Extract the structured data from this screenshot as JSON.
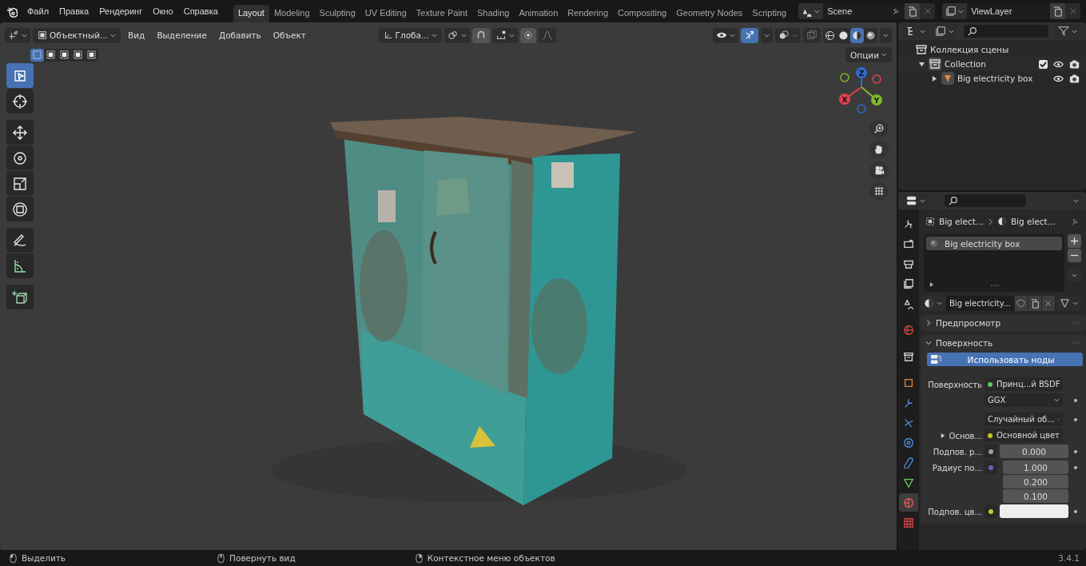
{
  "top_menu": [
    "Файл",
    "Правка",
    "Рендеринг",
    "Окно",
    "Справка"
  ],
  "workspaces": [
    {
      "label": "Layout",
      "selected": true
    },
    {
      "label": "Modeling",
      "selected": false
    },
    {
      "label": "Sculpting",
      "selected": false
    },
    {
      "label": "UV Editing",
      "selected": false
    },
    {
      "label": "Texture Paint",
      "selected": false
    },
    {
      "label": "Shading",
      "selected": false
    },
    {
      "label": "Animation",
      "selected": false
    },
    {
      "label": "Rendering",
      "selected": false
    },
    {
      "label": "Compositing",
      "selected": false
    },
    {
      "label": "Geometry Nodes",
      "selected": false
    },
    {
      "label": "Scripting",
      "selected": false
    }
  ],
  "scene": {
    "name": "Scene"
  },
  "view_layer": {
    "name": "ViewLayer"
  },
  "viewport": {
    "mode": "Объектный...",
    "menus": [
      "Вид",
      "Выделение",
      "Добавить",
      "Объект"
    ],
    "orientation": "Глоба...",
    "options": "Опции",
    "gizmo_on": true,
    "select_modes": [
      {
        "selected": true
      },
      {
        "selected": false
      },
      {
        "selected": false
      },
      {
        "selected": false
      },
      {
        "selected": false
      }
    ],
    "shading": [
      {
        "kind": "wireframe",
        "selected": false
      },
      {
        "kind": "solid",
        "selected": false
      },
      {
        "kind": "material",
        "selected": true
      },
      {
        "kind": "rendered",
        "selected": false
      }
    ],
    "tool_groups": [
      [
        {
          "kind": "select",
          "selected": true
        },
        {
          "kind": "cursor",
          "selected": false
        }
      ],
      [
        {
          "kind": "move",
          "selected": false
        },
        {
          "kind": "rotate",
          "selected": false
        },
        {
          "kind": "scale",
          "selected": false
        },
        {
          "kind": "transform",
          "selected": false
        }
      ],
      [
        {
          "kind": "annotate",
          "selected": false
        },
        {
          "kind": "measure",
          "selected": false
        }
      ],
      [
        {
          "kind": "add_cube",
          "selected": false
        }
      ]
    ],
    "axes": [
      {
        "label": "Z",
        "color": "#2f6ad0"
      },
      {
        "label": "X",
        "color": "#e0424f"
      },
      {
        "label": "Y",
        "color": "#80b82a"
      }
    ]
  },
  "outliner": {
    "tree": [
      {
        "label": "Коллекция сцены",
        "kind": "scene_collection",
        "children": [
          {
            "label": "Collection",
            "kind": "collection",
            "expanded": true,
            "checked": true,
            "children": [
              {
                "label": "Big electricity box",
                "kind": "mesh",
                "expanded": false
              }
            ]
          }
        ]
      }
    ]
  },
  "properties": {
    "tabs": [
      {
        "kind": "tool",
        "selected": false
      },
      {
        "kind": "render",
        "selected": false
      },
      {
        "kind": "output",
        "selected": false
      },
      {
        "kind": "view_layer",
        "selected": false
      },
      {
        "kind": "scene",
        "selected": false
      },
      {
        "kind": "world",
        "selected": false
      },
      {
        "kind": "collection",
        "selected": false
      },
      {
        "kind": "object",
        "selected": false
      },
      {
        "kind": "modifiers",
        "selected": false
      },
      {
        "kind": "particles",
        "selected": false
      },
      {
        "kind": "physics",
        "selected": false
      },
      {
        "kind": "constraints",
        "selected": false
      },
      {
        "kind": "data",
        "selected": false
      },
      {
        "kind": "material",
        "selected": true
      },
      {
        "kind": "texture",
        "selected": false
      }
    ],
    "breadcrumb": [
      "Big elect...",
      "Big elect..."
    ],
    "slots": [
      {
        "label": "Big electricity box",
        "selected": true
      }
    ],
    "material_name": "Big electricity...",
    "panels": [
      {
        "title": "Предпросмотр",
        "expanded": false
      },
      {
        "title": "Поверхность",
        "expanded": true
      }
    ],
    "use_nodes": "Использовать ноды",
    "rows": [
      {
        "kind": "link",
        "label": "Поверхность",
        "value": "Принц...й BSDF",
        "color": "#63c763"
      },
      {
        "kind": "dropdown",
        "value": "GGX"
      },
      {
        "kind": "dropdown",
        "value": "Случайный об..."
      },
      {
        "kind": "link",
        "label": "Основ...",
        "value": "Основной цвет",
        "color": "#c7c729",
        "expandable": true
      },
      {
        "kind": "number",
        "label": "Подпов. р...",
        "value": "0.000",
        "color": "#a1a1a1"
      },
      {
        "kind": "vector",
        "label": "Радиус по...",
        "values": [
          "1.000",
          "0.200",
          "0.100"
        ],
        "color": "#6363c7"
      },
      {
        "kind": "swatch",
        "label": "Подпов. цв...",
        "color": "#c7c729",
        "swatch": {
          "color": "#eeeeee"
        }
      }
    ]
  },
  "status_bar": {
    "hints": [
      "Выделить",
      "Повернуть вид",
      "Контекстное меню объектов"
    ],
    "version": "3.4.1"
  }
}
